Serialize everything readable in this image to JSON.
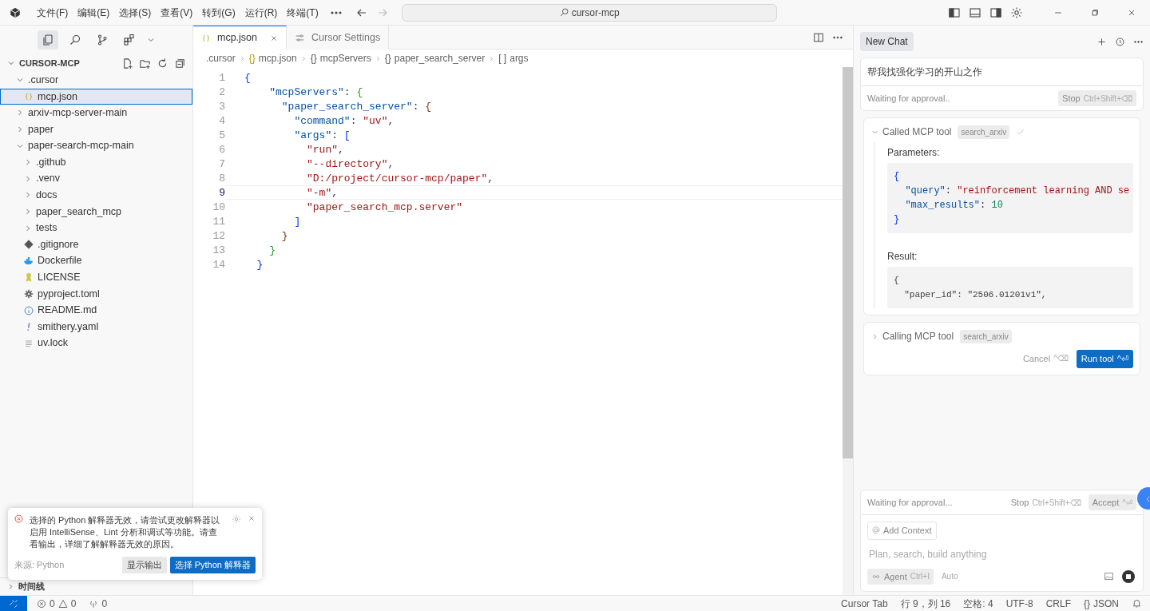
{
  "menu": [
    "文件(F)",
    "编辑(E)",
    "选择(S)",
    "查看(V)",
    "转到(G)",
    "运行(R)",
    "终端(T)"
  ],
  "nav": {
    "back_enabled": true,
    "forward_enabled": false
  },
  "command_center": {
    "text": "cursor-mcp"
  },
  "activity_tabs": [
    {
      "kind": "explorer",
      "selected": true
    },
    {
      "kind": "search",
      "selected": false
    },
    {
      "kind": "source-control",
      "selected": false
    },
    {
      "kind": "extensions",
      "selected": false
    }
  ],
  "explorer": {
    "title": "CURSOR-MCP",
    "expanded": true,
    "items": [
      {
        "label": ".cursor",
        "kind": "folder",
        "expanded": true,
        "selected": false,
        "children": [
          {
            "label": "mcp.json",
            "kind": "json",
            "selected": true
          }
        ]
      },
      {
        "label": "arxiv-mcp-server-main",
        "kind": "folder",
        "expanded": false,
        "selected": false
      },
      {
        "label": "paper",
        "kind": "folder",
        "expanded": false,
        "selected": false
      },
      {
        "label": "paper-search-mcp-main",
        "kind": "folder",
        "expanded": true,
        "selected": false,
        "children": [
          {
            "label": ".github",
            "kind": "folder",
            "expanded": false,
            "selected": false
          },
          {
            "label": ".venv",
            "kind": "folder",
            "expanded": false,
            "selected": false
          },
          {
            "label": "docs",
            "kind": "folder",
            "expanded": false,
            "selected": false
          },
          {
            "label": "paper_search_mcp",
            "kind": "folder",
            "expanded": false,
            "selected": false
          },
          {
            "label": "tests",
            "kind": "folder",
            "expanded": false,
            "selected": false
          },
          {
            "label": ".gitignore",
            "kind": "git",
            "selected": false
          },
          {
            "label": "Dockerfile",
            "kind": "docker",
            "selected": false
          },
          {
            "label": "LICENSE",
            "kind": "license",
            "selected": false
          },
          {
            "label": "pyproject.toml",
            "kind": "gear",
            "selected": false
          },
          {
            "label": "README.md",
            "kind": "info",
            "selected": false
          },
          {
            "label": "smithery.yaml",
            "kind": "yaml",
            "selected": false
          },
          {
            "label": "uv.lock",
            "kind": "text",
            "selected": false
          }
        ]
      }
    ]
  },
  "sidebar_sections": [
    {
      "label": "时间线",
      "expanded": false
    }
  ],
  "editor_tabs": [
    {
      "label": "mcp.json",
      "kind": "json",
      "selected": true
    },
    {
      "label": "Cursor Settings",
      "kind": "settings",
      "selected": false
    }
  ],
  "breadcrumbs": [
    {
      "label": ".cursor"
    },
    {
      "label": "mcp.json",
      "glyph": "{}"
    },
    {
      "label": "mcpServers",
      "glyph": "{}"
    },
    {
      "label": "paper_search_server",
      "glyph": "{}"
    },
    {
      "label": "args",
      "glyph": "[ ]"
    }
  ],
  "code": [
    {
      "number": "1",
      "current": false,
      "tokens": [
        {
          "text": "{",
          "kind": "bracket",
          "color": "#0431fa"
        }
      ]
    },
    {
      "number": "2",
      "current": false,
      "tokens": [
        {
          "text": "    \"mcpServers\"",
          "kind": "key"
        },
        {
          "text": ": ",
          "kind": "punct"
        },
        {
          "text": "{",
          "kind": "bracket",
          "color": "#319331"
        }
      ]
    },
    {
      "number": "3",
      "current": false,
      "tokens": [
        {
          "text": "      \"paper_search_server\"",
          "kind": "key"
        },
        {
          "text": ": ",
          "kind": "punct"
        },
        {
          "text": "{",
          "kind": "bracket",
          "color": "#7b3814"
        }
      ]
    },
    {
      "number": "4",
      "current": false,
      "tokens": [
        {
          "text": "        \"command\"",
          "kind": "key"
        },
        {
          "text": ": ",
          "kind": "punct"
        },
        {
          "text": "\"uv\"",
          "kind": "string"
        },
        {
          "text": ",",
          "kind": "punct"
        }
      ]
    },
    {
      "number": "5",
      "current": false,
      "tokens": [
        {
          "text": "        \"args\"",
          "kind": "key"
        },
        {
          "text": ": ",
          "kind": "punct"
        },
        {
          "text": "[",
          "kind": "bracket",
          "color": "#0431fa"
        }
      ]
    },
    {
      "number": "6",
      "current": false,
      "tokens": [
        {
          "text": "          \"run\"",
          "kind": "string"
        },
        {
          "text": ",",
          "kind": "punct"
        }
      ]
    },
    {
      "number": "7",
      "current": false,
      "tokens": [
        {
          "text": "          \"--directory\"",
          "kind": "string"
        },
        {
          "text": ",",
          "kind": "punct"
        }
      ]
    },
    {
      "number": "8",
      "current": false,
      "tokens": [
        {
          "text": "          \"D:/project/cursor-mcp/paper\"",
          "kind": "string"
        },
        {
          "text": ",",
          "kind": "punct"
        }
      ]
    },
    {
      "number": "9",
      "current": true,
      "tokens": [
        {
          "text": "          \"-m\"",
          "kind": "string"
        },
        {
          "text": ",",
          "kind": "punct"
        }
      ]
    },
    {
      "number": "10",
      "current": false,
      "tokens": [
        {
          "text": "          \"paper_search_mcp.server\"",
          "kind": "string"
        }
      ]
    },
    {
      "number": "11",
      "current": false,
      "tokens": [
        {
          "text": "        ]",
          "kind": "bracket",
          "color": "#0431fa"
        }
      ]
    },
    {
      "number": "12",
      "current": false,
      "tokens": [
        {
          "text": "      }",
          "kind": "bracket",
          "color": "#7b3814"
        }
      ]
    },
    {
      "number": "13",
      "current": false,
      "tokens": [
        {
          "text": "    }",
          "kind": "bracket",
          "color": "#319331"
        }
      ]
    },
    {
      "number": "14",
      "current": false,
      "tokens": [
        {
          "text": "  }",
          "kind": "bracket",
          "color": "#0431fa"
        }
      ]
    }
  ],
  "chat": {
    "tab": {
      "label": "New Chat",
      "selected": true
    },
    "message": {
      "text": "帮我找强化学习的开山之作",
      "status": "Waiting for approval..",
      "stop": {
        "label": "Stop",
        "shortcut": "Ctrl+Shift+⌫"
      }
    },
    "tool_calls": [
      {
        "title": "Called MCP tool",
        "tool": "search_arxiv",
        "expanded": true,
        "done": true,
        "parameters_label": "Parameters:",
        "parameters": [
          [
            {
              "text": "{",
              "kind": "bracket",
              "color": "#0431fa"
            }
          ],
          [
            {
              "text": "  \"query\"",
              "kind": "key"
            },
            {
              "text": ": ",
              "kind": "punct"
            },
            {
              "text": "\"reinforcement learning AND se",
              "kind": "string"
            }
          ],
          [
            {
              "text": "  \"max_results\"",
              "kind": "key"
            },
            {
              "text": ": ",
              "kind": "punct"
            },
            {
              "text": "10",
              "kind": "number"
            }
          ],
          [
            {
              "text": "}",
              "kind": "bracket",
              "color": "#0431fa"
            }
          ]
        ],
        "result_label": "Result:",
        "result": [
          [
            {
              "text": "{"
            }
          ],
          [
            {
              "text": "  \"paper_id\": \"2506.01201v1\","
            }
          ]
        ]
      },
      {
        "title": "Calling MCP tool",
        "tool": "search_arxiv",
        "expanded": false,
        "done": false,
        "cancel": {
          "label": "Cancel",
          "shortcut": "^⌫"
        },
        "run": {
          "label": "Run tool",
          "shortcut": "^⏎"
        }
      }
    ],
    "composer": {
      "status": "Waiting for approval...",
      "stop": {
        "label": "Stop",
        "shortcut": "Ctrl+Shift+⌫"
      },
      "accept": {
        "label": "Accept",
        "shortcut": "^⏎"
      },
      "add_context": "Add Context",
      "placeholder": "Plan, search, build anything",
      "mode": {
        "label": "Agent",
        "shortcut": "Ctrl+I"
      },
      "model": "Auto"
    }
  },
  "notification": {
    "message": "选择的 Python 解释器无效，请尝试更改解释器以启用 IntelliSense、Lint 分析和调试等功能。请查看输出，详细了解解释器无效的原因。",
    "source": "来源: Python",
    "buttons": [
      {
        "label": "显示输出",
        "primary": false
      },
      {
        "label": "选择 Python 解释器",
        "primary": true
      }
    ]
  },
  "status_bar": {
    "left": [
      {
        "kind": "errors",
        "text": "0"
      },
      {
        "kind": "warnings",
        "text": "0"
      },
      {
        "kind": "ports",
        "text": "0"
      }
    ],
    "right": [
      "Cursor Tab",
      "行 9，列 16",
      "空格: 4",
      "UTF-8",
      "CRLF"
    ],
    "language": {
      "glyph": "{}",
      "text": "JSON"
    }
  }
}
